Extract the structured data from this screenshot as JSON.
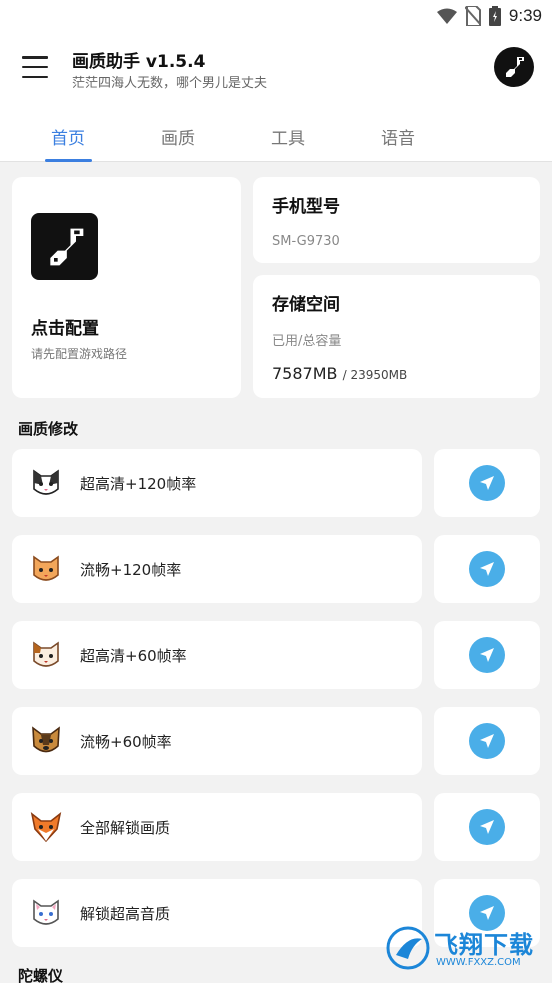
{
  "status_bar": {
    "time": "9:39"
  },
  "app_bar": {
    "title": "画质助手 v1.5.4",
    "subtitle": "茫茫四海人无数，哪个男儿是丈夫"
  },
  "tabs": [
    {
      "label": "首页",
      "active": true
    },
    {
      "label": "画质",
      "active": false
    },
    {
      "label": "工具",
      "active": false
    },
    {
      "label": "语音",
      "active": false
    }
  ],
  "config_card": {
    "title": "点击配置",
    "subtitle": "请先配置游戏路径"
  },
  "phone_card": {
    "title": "手机型号",
    "value": "SM-G9730"
  },
  "storage_card": {
    "title": "存储空间",
    "label": "已用/总容量",
    "used": "7587MB",
    "total": "/ 23950MB"
  },
  "sections": {
    "quality": "画质修改",
    "gyro": "陀螺仪"
  },
  "presets": [
    {
      "label": "超高清+120帧率",
      "icon": "cat-icon"
    },
    {
      "label": "流畅+120帧率",
      "icon": "cat-icon"
    },
    {
      "label": "超高清+60帧率",
      "icon": "cat-icon"
    },
    {
      "label": "流畅+60帧率",
      "icon": "dog-icon"
    },
    {
      "label": "全部解锁画质",
      "icon": "fox-icon"
    },
    {
      "label": "解锁超高音质",
      "icon": "cat-icon"
    }
  ],
  "watermark": {
    "text": "飞翔下载",
    "url": "WWW.FXXZ.COM"
  },
  "colors": {
    "accent": "#3b7fe0",
    "send": "#4aaee8",
    "background": "#f2f2f2"
  }
}
